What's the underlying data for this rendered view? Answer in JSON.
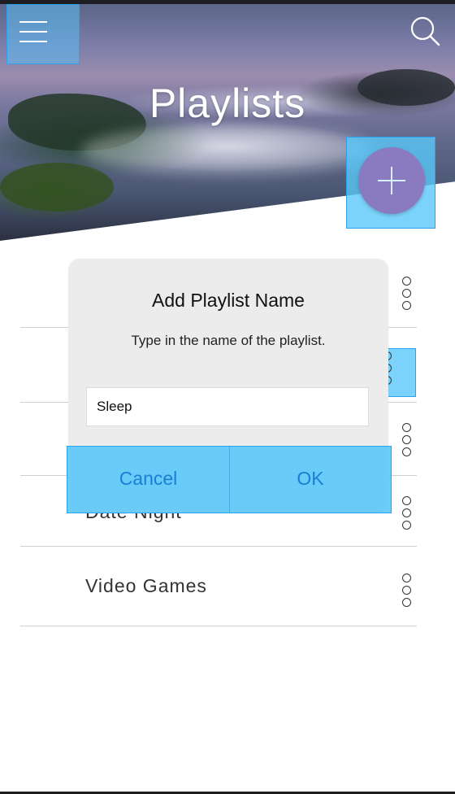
{
  "header": {
    "title": "Playlists",
    "menu_icon": "hamburger-icon",
    "search_icon": "search-icon",
    "add_icon": "plus-icon"
  },
  "playlists": [
    {
      "label": ""
    },
    {
      "label": ""
    },
    {
      "label": ""
    },
    {
      "label": "Date Night"
    },
    {
      "label": "Video Games"
    }
  ],
  "dialog": {
    "title": "Add Playlist Name",
    "message": "Type in the name of the playlist.",
    "input_value": "Sleep",
    "cancel_label": "Cancel",
    "ok_label": "OK"
  },
  "colors": {
    "accent_blue": "#1a7fd6",
    "fab_purple": "#8a7ac0",
    "highlight": "#5ac8fa"
  }
}
